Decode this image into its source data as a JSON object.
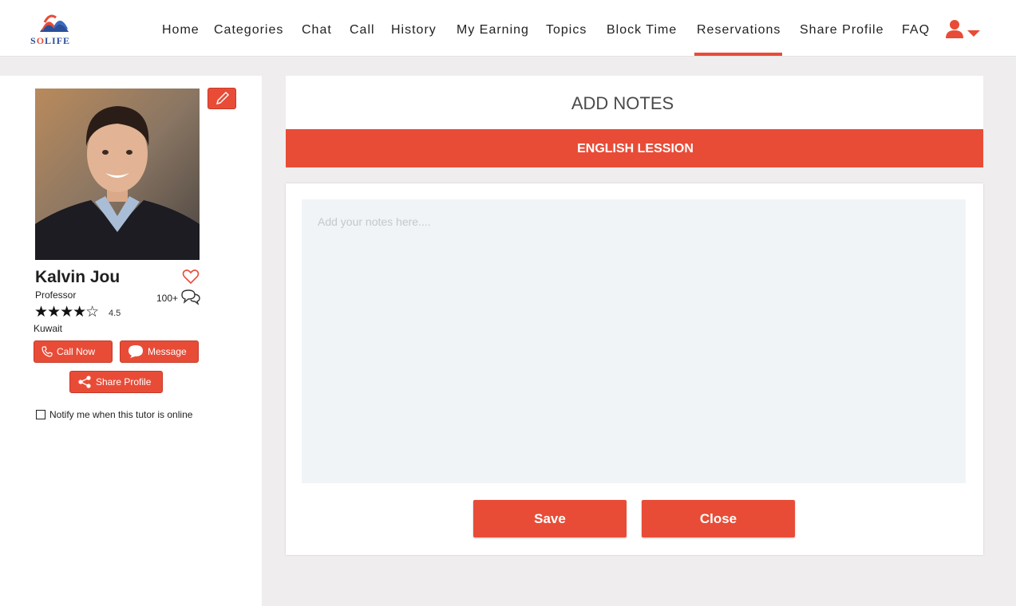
{
  "brand": {
    "logo_text": "SOLIFE",
    "accent_color": "#e84c37"
  },
  "nav": {
    "items": [
      {
        "label": "Home"
      },
      {
        "label": "Categories"
      },
      {
        "label": "Chat"
      },
      {
        "label": "Call"
      },
      {
        "label": "History"
      },
      {
        "label": "My Earning"
      },
      {
        "label": "Topics"
      },
      {
        "label": "Block Time"
      },
      {
        "label": "Reservations"
      },
      {
        "label": "Share Profile"
      },
      {
        "label": "FAQ"
      }
    ],
    "active": "Reservations",
    "user_menu_icon": "user-icon"
  },
  "profile": {
    "name": "Kalvin Jou",
    "title": "Professor",
    "review_count": "100+",
    "stars_display": "★★★★☆",
    "rating": "4.5",
    "country": "Kuwait",
    "call_label": "Call Now",
    "message_label": "Message",
    "share_label": "Share Profile",
    "notify_label": "Notify me when this tutor is online",
    "notify_checked": false
  },
  "notes_panel": {
    "title": "ADD NOTES",
    "lesson": "ENGLISH LESSION",
    "placeholder": "Add your notes here....",
    "value": "",
    "save_label": "Save",
    "close_label": "Close"
  }
}
